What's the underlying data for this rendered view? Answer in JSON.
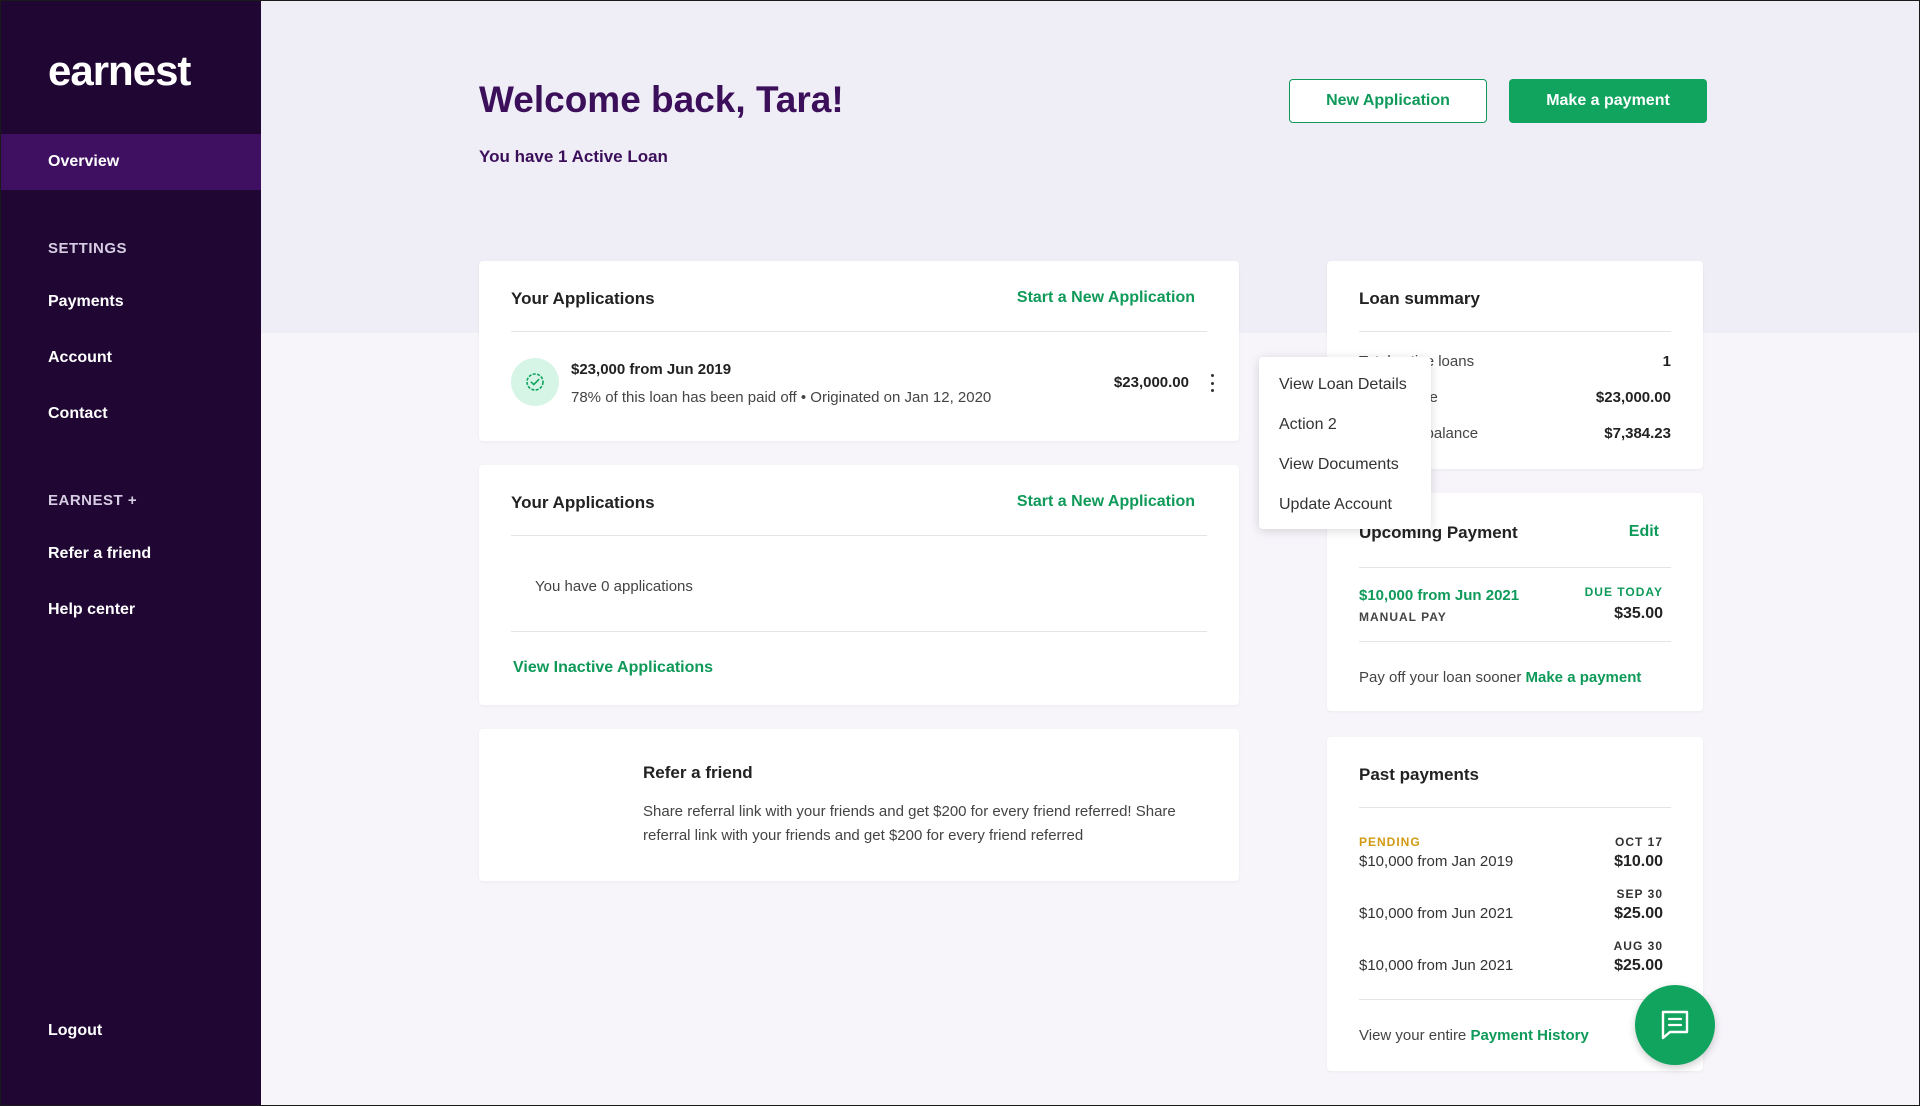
{
  "sidebar": {
    "logo": "earnest",
    "overview": "Overview",
    "settings_heading": "SETTINGS",
    "settings_items": [
      "Payments",
      "Account",
      "Contact"
    ],
    "earnest_heading": "EARNEST +",
    "earnest_items": [
      "Refer a friend",
      "Help center"
    ],
    "logout": "Logout"
  },
  "header": {
    "title": "Welcome back, Tara!",
    "subtitle": "You have 1 Active Loan",
    "new_application": "New Application",
    "make_payment": "Make a payment"
  },
  "applications_card": {
    "title": "Your Applications",
    "action": "Start a New Application",
    "loan": {
      "title": "$23,000 from Jun 2019",
      "detail": "78% of this loan has been paid off • Originated on Jan 12, 2020",
      "amount": "$23,000.00"
    }
  },
  "dropdown_menu": {
    "items": [
      "View Loan Details",
      "Action 2",
      "View Documents",
      "Update Account"
    ]
  },
  "applications_card_2": {
    "title": "Your Applications",
    "action": "Start a New Application",
    "empty_text": "You have 0 applications",
    "view_inactive": "View Inactive Applications"
  },
  "refer_card": {
    "title": "Refer a friend",
    "line1": "Share referral link with your friends and get $200 for every friend referred!  Share",
    "line2": "referral link with your friends and get $200 for every friend referred"
  },
  "loan_summary": {
    "title": "Loan summary",
    "rows": [
      {
        "label": "Total active loans",
        "value": "1"
      },
      {
        "label": "ate",
        "value": "$23,000.00"
      },
      {
        "label": "g balance",
        "value": "$7,384.23"
      }
    ]
  },
  "upcoming_payment": {
    "title": "Upcoming Payment",
    "edit": "Edit",
    "loan": "$10,000 from Jun 2021",
    "pay_type": "MANUAL PAY",
    "due_label": "DUE TODAY",
    "amount": "$35.00",
    "payoff_text": "Pay off your loan sooner",
    "payoff_link": "Make a payment"
  },
  "past_payments": {
    "title": "Past payments",
    "items": [
      {
        "status": "PENDING",
        "loan": "$10,000 from Jan 2019",
        "date": "OCT 17",
        "amount": "$10.00"
      },
      {
        "status": "",
        "loan": "$10,000 from Jun 2021",
        "date": "SEP 30",
        "amount": "$25.00"
      },
      {
        "status": "",
        "loan": "$10,000 from Jun 2021",
        "date": "AUG 30",
        "amount": "$25.00"
      }
    ],
    "history_text": "View your entire",
    "history_link": "Payment History"
  },
  "colors": {
    "sidebar_bg": "#1f0633",
    "sidebar_active": "#3f0f61",
    "brand_purple": "#3c0f5b",
    "accent_green": "#10a45f",
    "pending_gold": "#d19a12"
  },
  "icons": {
    "check": "check-circle-icon",
    "kebab": "more-vertical-icon",
    "chat": "chat-icon"
  }
}
